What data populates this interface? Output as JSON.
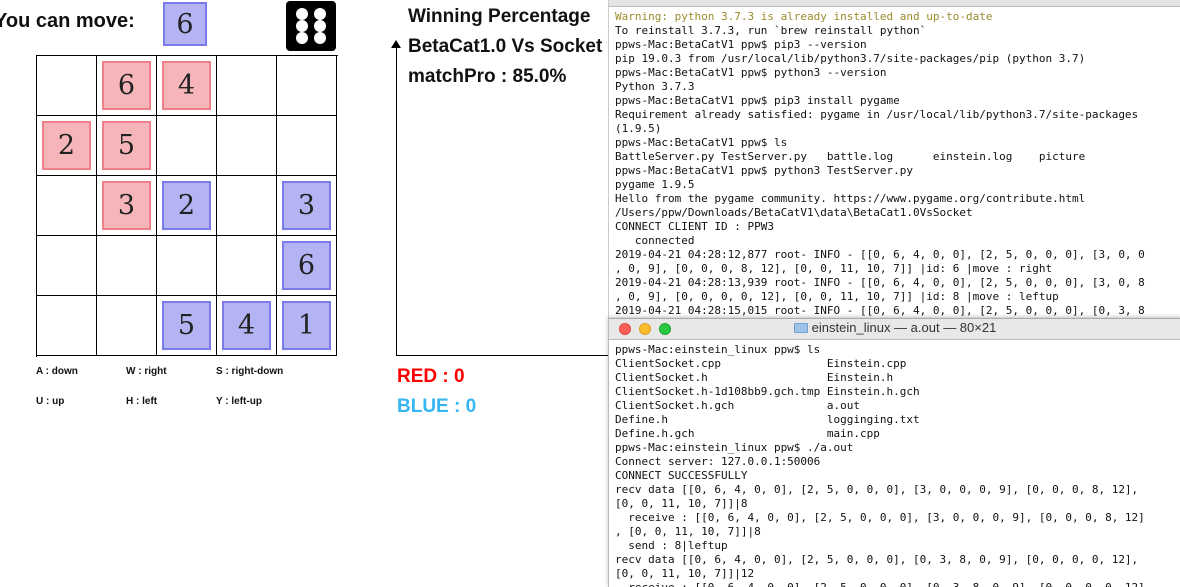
{
  "game": {
    "you_can_move_label": "You can move:",
    "move_piece_number": "6",
    "dice_value": 6,
    "colors": {
      "red_fill": "#f5b5b9",
      "red_border": "#ee8089",
      "blue_fill": "#b4b4f5",
      "blue_border": "#7b7bea"
    },
    "board": [
      [
        null,
        {
          "n": "6",
          "c": "red"
        },
        {
          "n": "4",
          "c": "red"
        },
        null,
        null
      ],
      [
        {
          "n": "2",
          "c": "red"
        },
        {
          "n": "5",
          "c": "red"
        },
        null,
        null,
        null
      ],
      [
        null,
        {
          "n": "3",
          "c": "red"
        },
        {
          "n": "2",
          "c": "blue"
        },
        null,
        {
          "n": "3",
          "c": "blue"
        }
      ],
      [
        null,
        null,
        null,
        null,
        {
          "n": "6",
          "c": "blue"
        }
      ],
      [
        null,
        null,
        {
          "n": "5",
          "c": "blue"
        },
        {
          "n": "4",
          "c": "blue"
        },
        {
          "n": "1",
          "c": "blue"
        }
      ]
    ],
    "keys": {
      "down": "A : down",
      "right": "W : right",
      "right_down": "S : right-down",
      "up": "U : up",
      "left": "H : left",
      "left_up": "Y : left-up"
    }
  },
  "stats": {
    "title": "Winning Percentage",
    "match": "BetaCat1.0 Vs Socket",
    "match_pro": "matchPro : 85.0%",
    "red": "RED : 0",
    "blue": "BLUE : 0",
    "red_color": "#ff0000",
    "blue_color": "#35b6f0"
  },
  "terminal1": {
    "lines": [
      {
        "t": "Warning: python 3.7.3 is already installed and up-to-date",
        "warn": true
      },
      {
        "t": "To reinstall 3.7.3, run `brew reinstall python`"
      },
      {
        "t": "ppws-Mac:BetaCatV1 ppw$ pip3 --version"
      },
      {
        "t": "pip 19.0.3 from /usr/local/lib/python3.7/site-packages/pip (python 3.7)"
      },
      {
        "t": "ppws-Mac:BetaCatV1 ppw$ python3 --version"
      },
      {
        "t": "Python 3.7.3"
      },
      {
        "t": "ppws-Mac:BetaCatV1 ppw$ pip3 install pygame"
      },
      {
        "t": "Requirement already satisfied: pygame in /usr/local/lib/python3.7/site-packages"
      },
      {
        "t": "(1.9.5)"
      },
      {
        "t": "ppws-Mac:BetaCatV1 ppw$ ls"
      },
      {
        "t": "BattleServer.py TestServer.py   battle.log      einstein.log    picture"
      },
      {
        "t": "ppws-Mac:BetaCatV1 ppw$ python3 TestServer.py"
      },
      {
        "t": "pygame 1.9.5"
      },
      {
        "t": "Hello from the pygame community. https://www.pygame.org/contribute.html"
      },
      {
        "t": "/Users/ppw/Downloads/BetaCatV1\\data\\BetaCat1.0VsSocket"
      },
      {
        "t": "CONNECT CLIENT ID : PPW3"
      },
      {
        "t": "   connected"
      },
      {
        "t": "2019-04-21 04:28:12,877 root- INFO - [[0, 6, 4, 0, 0], [2, 5, 0, 0, 0], [3, 0, 0"
      },
      {
        "t": ", 0, 9], [0, 0, 0, 8, 12], [0, 0, 11, 10, 7]] |id: 6 |move : right"
      },
      {
        "t": "2019-04-21 04:28:13,939 root- INFO - [[0, 6, 4, 0, 0], [2, 5, 0, 0, 0], [3, 0, 8"
      },
      {
        "t": ", 0, 9], [0, 0, 0, 0, 12], [0, 0, 11, 10, 7]] |id: 8 |move : leftup"
      },
      {
        "t": "2019-04-21 04:28:15,015 root- INFO - [[0, 6, 4, 0, 0], [2, 5, 0, 0, 0], [0, 3, 8"
      }
    ]
  },
  "terminal2": {
    "title": "einstein_linux — a.out — 80×21",
    "lines": [
      "ppws-Mac:einstein_linux ppw$ ls",
      "ClientSocket.cpp                Einstein.cpp",
      "ClientSocket.h                  Einstein.h",
      "ClientSocket.h-1d108bb9.gch.tmp Einstein.h.gch",
      "ClientSocket.h.gch              a.out",
      "Define.h                        logginging.txt",
      "Define.h.gch                    main.cpp",
      "ppws-Mac:einstein_linux ppw$ ./a.out",
      "Connect server: 127.0.0.1:50006",
      "CONNECT SUCCESSFULLY",
      "recv data [[0, 6, 4, 0, 0], [2, 5, 0, 0, 0], [3, 0, 0, 0, 9], [0, 0, 0, 8, 12],",
      "[0, 0, 11, 10, 7]]|8",
      "  receive : [[0, 6, 4, 0, 0], [2, 5, 0, 0, 0], [3, 0, 0, 0, 9], [0, 0, 0, 8, 12]",
      ", [0, 0, 11, 10, 7]]|8",
      "  send : 8|leftup",
      "recv data [[0, 6, 4, 0, 0], [2, 5, 0, 0, 0], [0, 3, 8, 0, 9], [0, 0, 0, 0, 12],",
      "[0, 0, 11, 10, 7]]|12",
      "  receive : [[0, 6, 4, 0, 0], [2, 5, 0, 0, 0], [0, 3, 8, 0, 9], [0, 0, 0, 0, 12]"
    ]
  }
}
